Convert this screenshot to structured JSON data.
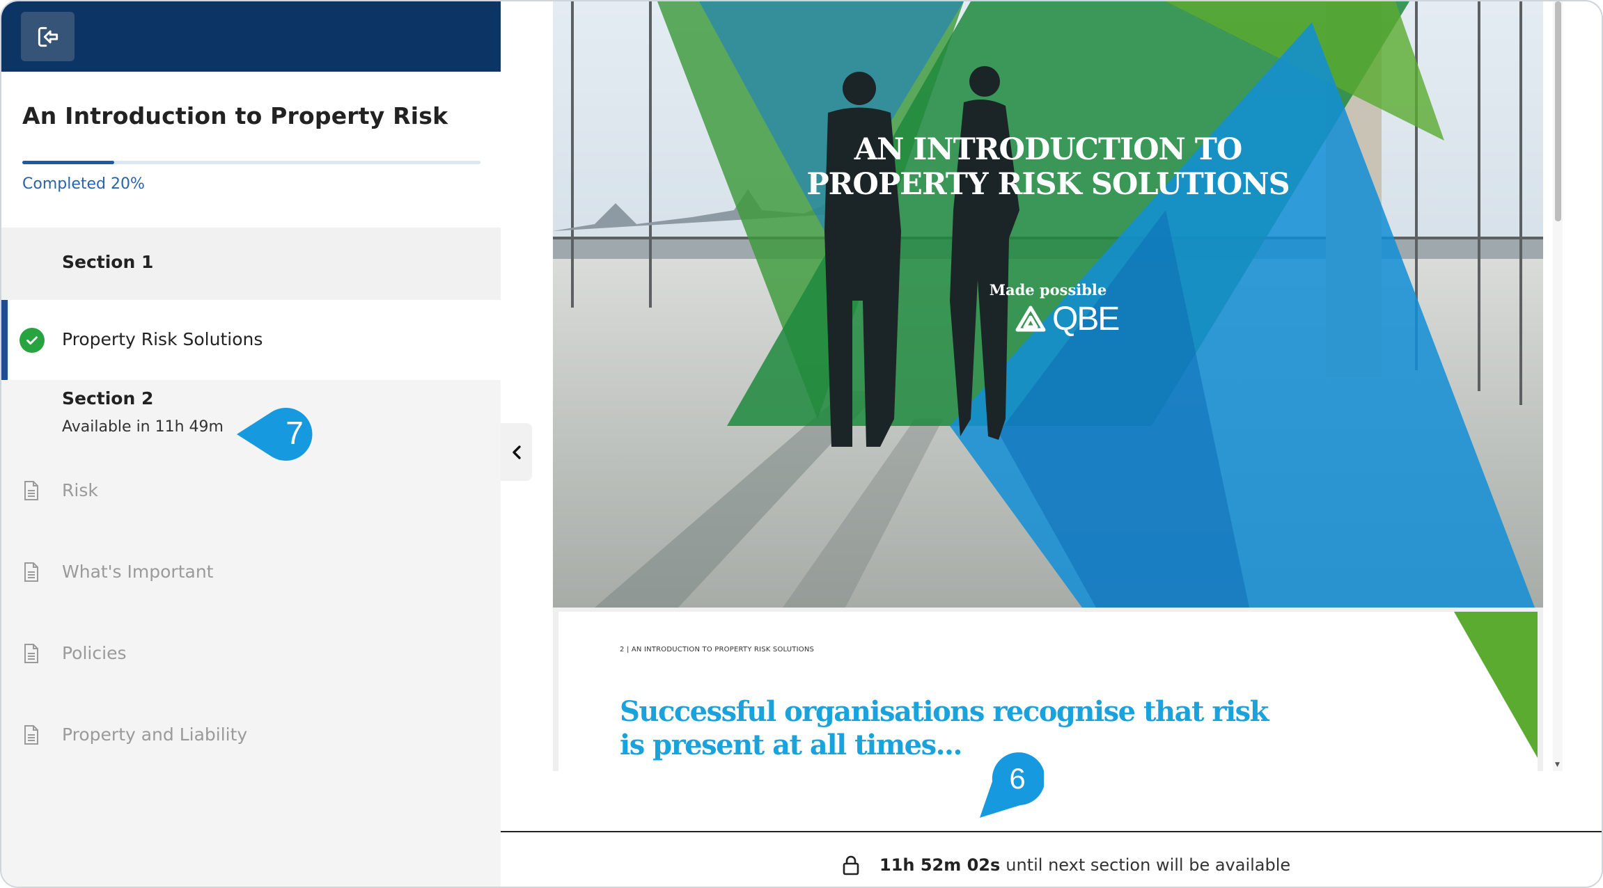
{
  "sidebar": {
    "course_title": "An Introduction to Property Risk",
    "progress": {
      "percent": 20,
      "label": "Completed 20%"
    },
    "section1": {
      "title": "Section 1"
    },
    "active_lesson": {
      "label": "Property Risk Solutions",
      "completed": true
    },
    "section2": {
      "title": "Section 2",
      "availability": "Available in 11h 49m"
    },
    "locked_lessons": [
      {
        "label": "Risk"
      },
      {
        "label": "What's Important"
      },
      {
        "label": "Policies"
      },
      {
        "label": "Property and Liability"
      }
    ]
  },
  "markers": {
    "m7": "7",
    "m6": "6"
  },
  "document": {
    "cover_title_line1": "AN INTRODUCTION TO",
    "cover_title_line2": "PROPERTY RISK SOLUTIONS",
    "made_possible": "Made possible",
    "brand": "QBE",
    "page2_header": "2  |  AN INTRODUCTION TO PROPERTY RISK SOLUTIONS",
    "page2_heading_line1": "Successful organisations recognise that risk",
    "page2_heading_line2": "is present at all times..."
  },
  "footer": {
    "countdown": "11h 52m 02s",
    "message": "until next section will be available"
  },
  "colors": {
    "header_navy": "#0c3566",
    "accent_blue": "#1d5aa8",
    "check_green": "#27a33f",
    "marker_blue": "#1699de",
    "brand_green": "#5aab2f",
    "brand_blue": "#1aa2dc"
  },
  "icons": [
    "exit-icon",
    "check-icon",
    "document-icon",
    "chevron-left-icon",
    "lock-icon",
    "qbe-logo-icon"
  ]
}
